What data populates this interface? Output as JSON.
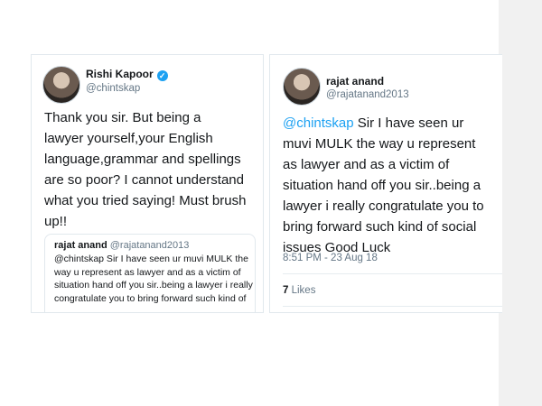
{
  "tweet_reply": {
    "author_name": "Rishi Kapoor",
    "author_handle": "@chintskap",
    "verified_icon": "check-icon",
    "text_lines": [
      "Thank you sir. But being a",
      "lawyer yourself,your English",
      "language,grammar and spellings",
      "are so poor? I cannot understand",
      "what you tried saying! Must brush",
      "up!!"
    ],
    "quoted": {
      "author_name": "rajat anand",
      "author_handle": "@rajatanand2013",
      "text_lines": [
        "@chintskap Sir I have seen ur muvi MULK the",
        "way u represent as lawyer and as a victim of",
        "situation hand off you sir..being a lawyer i really",
        "congratulate you to bring forward such kind of"
      ]
    }
  },
  "tweet_original": {
    "author_name": "rajat anand",
    "author_handle": "@rajatanand2013",
    "mention": "@chintskap",
    "text_first_line_rest": " Sir I have seen ur",
    "text_lines": [
      "muvi MULK the way u represent",
      "as lawyer and as a victim of",
      "situation hand off you sir..being a",
      "lawyer i really congratulate you to",
      "bring forward such kind of social",
      "issues Good Luck"
    ],
    "timestamp": "8:51 PM - 23 Aug 18",
    "likes_count": "7",
    "likes_label": "Likes"
  },
  "colors": {
    "link": "#1da1f2",
    "text": "#14171a",
    "muted": "#657786"
  }
}
